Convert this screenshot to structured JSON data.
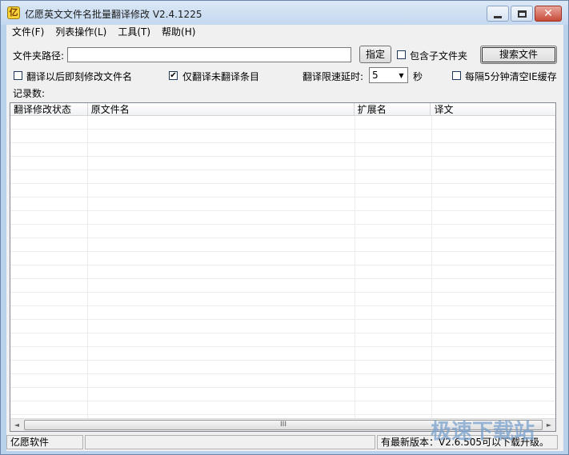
{
  "window": {
    "title": "亿愿英文文件名批量翻译修改 V2.4.1225",
    "close_glyph": "✕"
  },
  "menu": [
    "文件(F)",
    "列表操作(L)",
    "工具(T)",
    "帮助(H)"
  ],
  "folder": {
    "label": "文件夹路径:",
    "value": "",
    "assign_button": "指定",
    "include_subfolders": {
      "label": "包含子文件夹",
      "checked": false
    },
    "search_button": "搜索文件"
  },
  "options": {
    "rename_after": {
      "label": "翻译以后即刻修改文件名",
      "checked": false
    },
    "only_untranslated": {
      "label": "仅翻译未翻译条目",
      "checked": true,
      "mark": "✔"
    },
    "delay_label": "翻译限速延时:",
    "delay_value": "5",
    "delay_unit": "秒",
    "clear_ie_cache": {
      "label": "每隔5分钟清空IE缓存",
      "checked": false
    }
  },
  "records_label": "记录数:",
  "table": {
    "columns": [
      "翻译修改状态",
      "原文件名",
      "扩展名",
      "译文"
    ],
    "rows": []
  },
  "scrollbar": {
    "left_arrow": "◄",
    "right_arrow": "►",
    "grip": "III"
  },
  "status": {
    "left": "亿愿软件",
    "middle": "",
    "right": "有最新版本：V2.6.505可以下载升级。"
  },
  "watermark": "极速下载站"
}
